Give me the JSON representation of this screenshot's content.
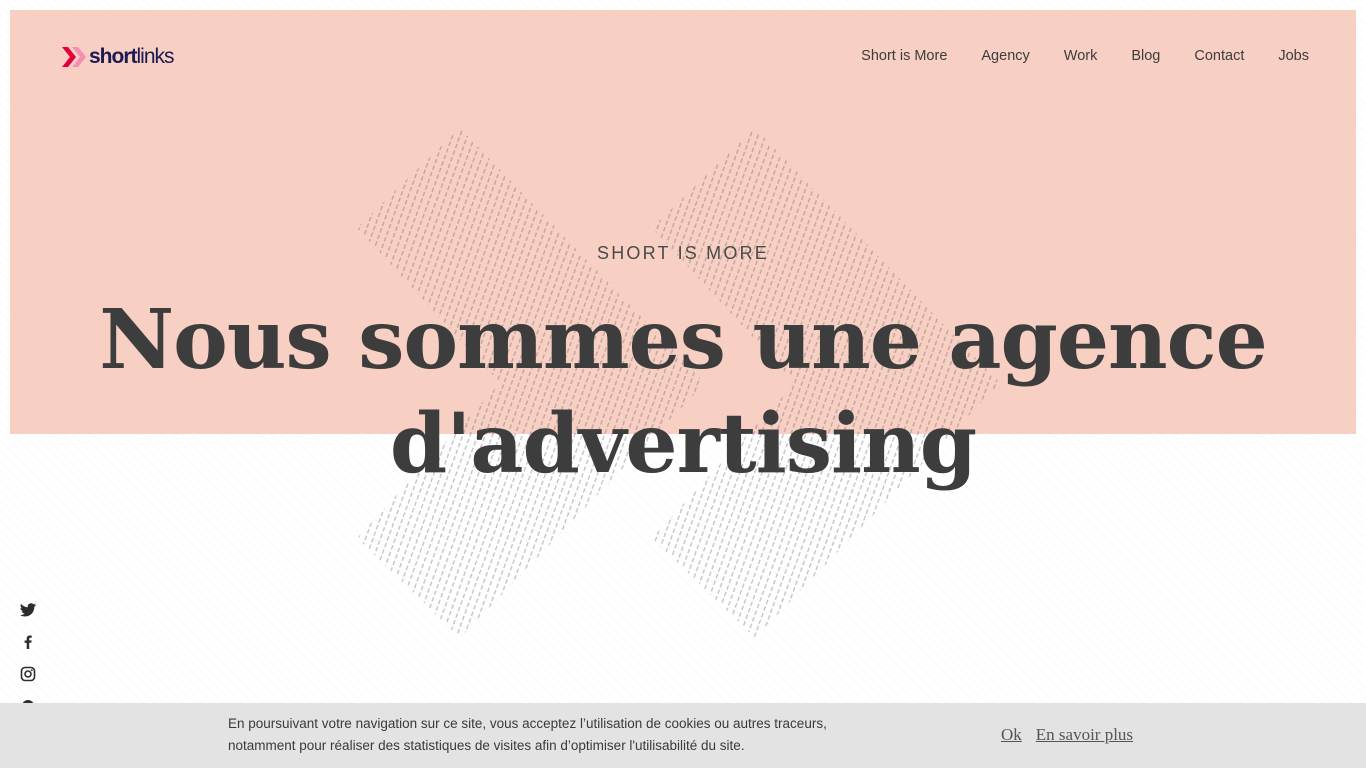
{
  "brand": {
    "name_bold": "short",
    "name_light": "links",
    "logo_icon": "double-chevron-logo-icon",
    "accent_color": "#e4003a",
    "accent_secondary": "#f48fb1",
    "text_color": "#1b1a55"
  },
  "nav": {
    "items": [
      {
        "label": "Short is More"
      },
      {
        "label": "Agency"
      },
      {
        "label": "Work"
      },
      {
        "label": "Blog"
      },
      {
        "label": "Contact"
      },
      {
        "label": "Jobs"
      }
    ]
  },
  "hero": {
    "eyebrow": "SHORT IS MORE",
    "headline_line1": "Nous sommes une agence",
    "headline_line2": "d'advertising",
    "background_color": "#f7cfc3",
    "decoration_icon": "double-chevron-pattern-icon"
  },
  "social": {
    "icons": [
      "twitter-icon",
      "facebook-icon",
      "instagram-icon",
      "more-icon"
    ]
  },
  "cookie_banner": {
    "text_line1": "En poursuivant votre navigation sur ce site, vous acceptez l’utilisation de cookies ou autres traceurs,",
    "text_line2": "notamment pour réaliser des statistiques de visites afin d’optimiser l'utilisabilité du site.",
    "ok_label": "Ok",
    "more_label": "En savoir plus",
    "background_color": "#e3e3e3"
  }
}
